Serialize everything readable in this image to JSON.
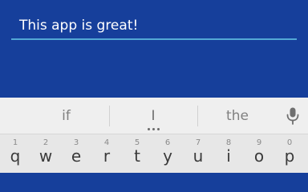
{
  "text_field": {
    "value": "This app is great!"
  },
  "keyboard": {
    "suggestions": [
      "if",
      "I",
      "the"
    ],
    "mic_icon": "microphone-icon",
    "more_suggestions_icon": "more-dots-icon",
    "keys": [
      {
        "letter": "q",
        "hint": "1"
      },
      {
        "letter": "w",
        "hint": "2"
      },
      {
        "letter": "e",
        "hint": "3"
      },
      {
        "letter": "r",
        "hint": "4"
      },
      {
        "letter": "t",
        "hint": "5"
      },
      {
        "letter": "y",
        "hint": "6"
      },
      {
        "letter": "u",
        "hint": "7"
      },
      {
        "letter": "i",
        "hint": "8"
      },
      {
        "letter": "o",
        "hint": "9"
      },
      {
        "letter": "p",
        "hint": "0"
      }
    ]
  },
  "colors": {
    "app_background": "#163f9b",
    "field_underline": "#53a8d6",
    "keyboard_background": "#e7e7e7"
  }
}
